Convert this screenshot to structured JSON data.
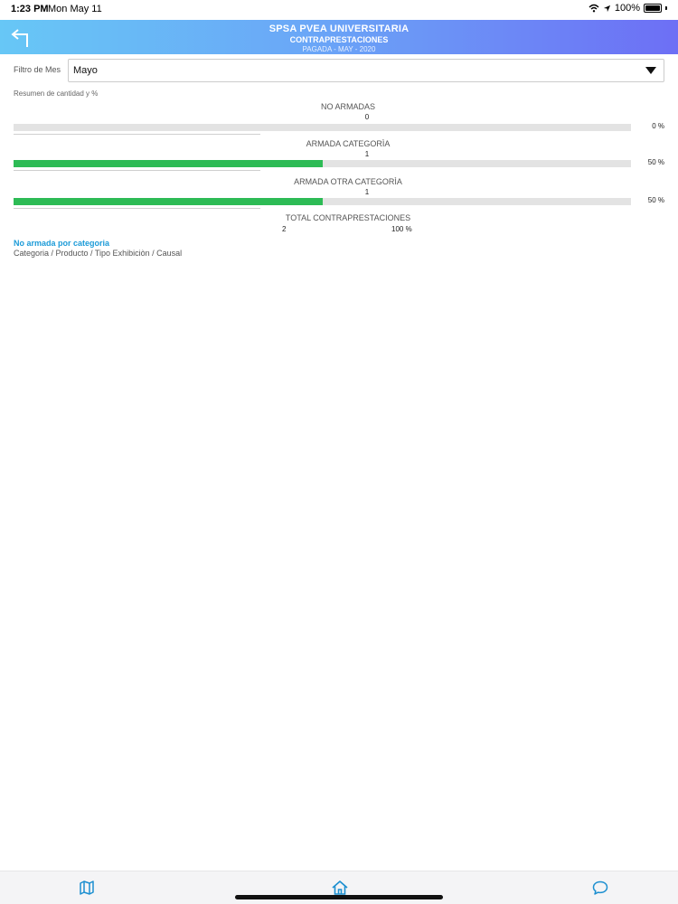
{
  "status": {
    "time": "1:23 PM",
    "date": "Mon May 11",
    "battery": "100%"
  },
  "header": {
    "title": "SPSA PVEA UNIVERSITARIA",
    "subtitle": "CONTRAPRESTACIONES",
    "period": "PAGADA - MAY - 2020"
  },
  "filter": {
    "label": "Filtro de Mes",
    "value": "Mayo"
  },
  "summary": {
    "title": "Resumen de cantidad y %",
    "metrics": [
      {
        "label": "NO ARMADAS",
        "count": "0",
        "percent_label": "0 %",
        "fraction": 0.0
      },
      {
        "label": "ARMADA CATEGORÌA",
        "count": "1",
        "percent_label": "50 %",
        "fraction": 0.5
      },
      {
        "label": "ARMADA OTRA CATEGORÌA",
        "count": "1",
        "percent_label": "50 %",
        "fraction": 0.5
      }
    ],
    "total": {
      "label": "TOTAL CONTRAPRESTACIONES",
      "count": "2",
      "percent_label": "100 %"
    }
  },
  "section": {
    "link": "No armada por categoria",
    "path": "Categoria / Producto / Tipo Exhibiciòn / Causal"
  },
  "colors": {
    "bar_fill": "#2dbb55",
    "bar_track": "#e3e3e3",
    "link": "#1c9bd8",
    "tab_icon": "#1c8fd0"
  },
  "tabs": [
    {
      "icon": "map-icon"
    },
    {
      "icon": "home-icon"
    },
    {
      "icon": "chat-icon"
    }
  ]
}
